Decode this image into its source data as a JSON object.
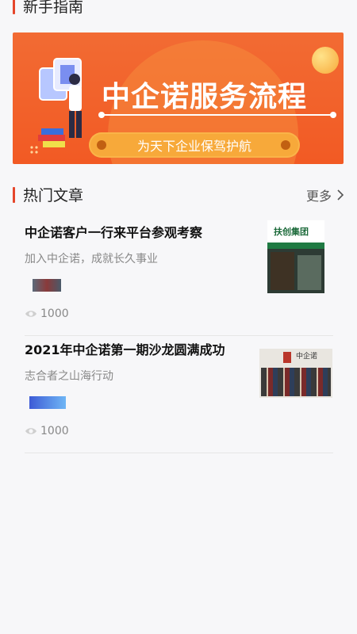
{
  "guide_section": {
    "title": "新手指南"
  },
  "banner": {
    "title": "中企诺服务流程",
    "slogan": "为天下企业保驾护航"
  },
  "hot_section": {
    "title": "热门文章",
    "more_label": "更多"
  },
  "articles": [
    {
      "title": "中企诺客户一行来平台参观考察",
      "subtitle": "加入中企诺，成就长久事业",
      "views": "1000",
      "thumb_sign": "扶创集团"
    },
    {
      "title": "2021年中企诺第一期沙龙圆满成功",
      "subtitle": "志合者之山海行动",
      "views": "1000",
      "thumb_sign": "中企诺"
    }
  ]
}
